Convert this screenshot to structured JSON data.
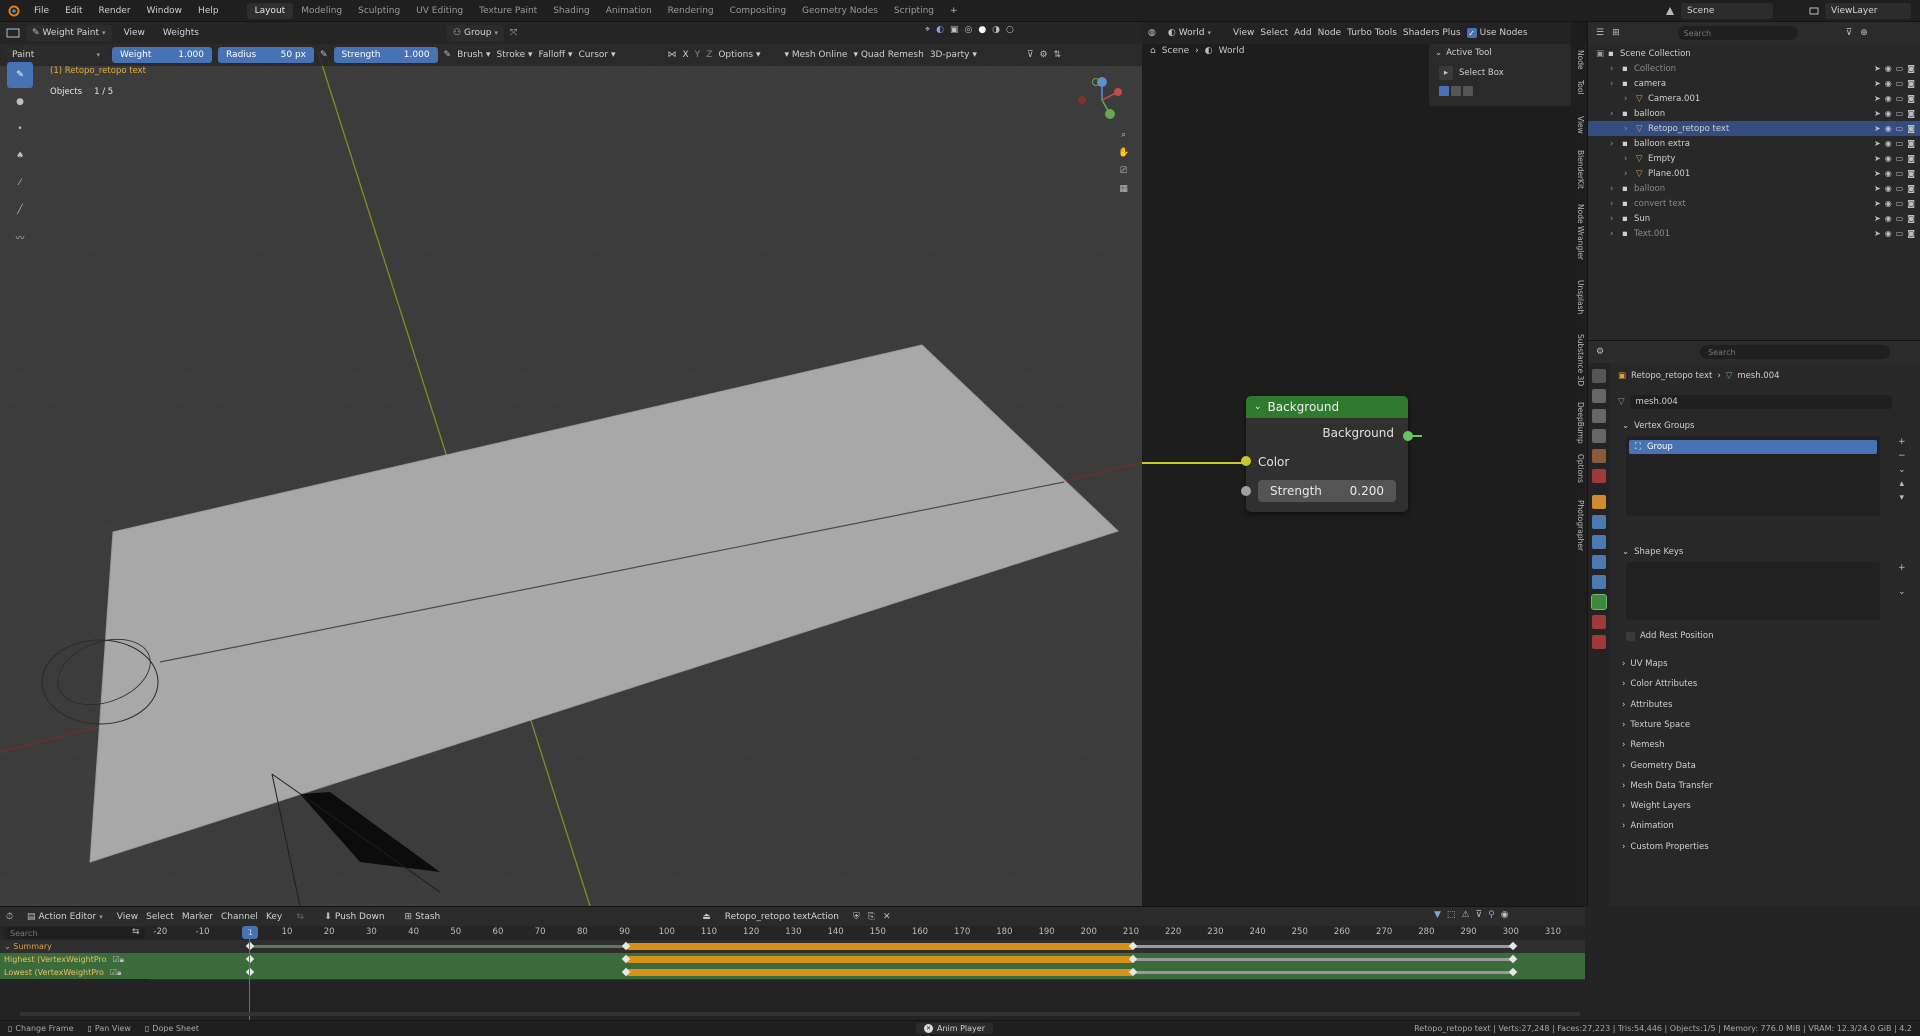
{
  "topbar": {
    "menus": [
      "File",
      "Edit",
      "Render",
      "Window",
      "Help"
    ],
    "workspaces": [
      "Layout",
      "Modeling",
      "Sculpting",
      "UV Editing",
      "Texture Paint",
      "Shading",
      "Animation",
      "Rendering",
      "Compositing",
      "Geometry Nodes",
      "Scripting"
    ],
    "active_workspace": "Layout",
    "scene": "Scene",
    "view_layer": "ViewLayer"
  },
  "viewport": {
    "mode": "Weight Paint",
    "view_menu": "View",
    "weights_menu": "Weights",
    "group_label": "Group",
    "brush_name": "Paint",
    "weight_label": "Weight",
    "weight_value": "1.000",
    "radius_label": "Radius",
    "radius_value": "50 px",
    "strength_label": "Strength",
    "strength_value": "1.000",
    "brush_menu": "Brush",
    "stroke_menu": "Stroke",
    "falloff_menu": "Falloff",
    "cursor_menu": "Cursor",
    "options_menu": "Options",
    "mesh_online": "Mesh Online",
    "quad_remesh": "Quad Remesh",
    "party": "3D-party",
    "axes": [
      "X",
      "Y",
      "Z"
    ],
    "object_name": "(1) Retopo_retopo text",
    "objects_label": "Objects",
    "objects_count": "1 / 5"
  },
  "node_editor": {
    "world": "World",
    "menus": [
      "View",
      "Select",
      "Add",
      "Node"
    ],
    "turbo_tools": "Turbo Tools",
    "shaders_plus": "Shaders Plus",
    "use_nodes": "Use Nodes",
    "breadcrumb": [
      "Scene",
      "World"
    ],
    "node": {
      "title": "Background",
      "output": "Background",
      "input_color": "Color",
      "strength_label": "Strength",
      "strength_value": "0.200"
    },
    "active_tool_title": "Active Tool",
    "active_tool_name": "Select Box",
    "side_tabs": [
      "Node",
      "Tool",
      "View",
      "BlenderKit",
      "Node Wrangler",
      "Unsplash",
      "Substance 3D",
      "DeepBump",
      "Options",
      "Photographer"
    ]
  },
  "outliner": {
    "search_placeholder": "Search",
    "items": [
      {
        "label": "Scene Collection",
        "indent": 0
      },
      {
        "label": "Collection",
        "indent": 1,
        "dim": true
      },
      {
        "label": "camera",
        "indent": 1
      },
      {
        "label": "Camera.001",
        "indent": 2
      },
      {
        "label": "balloon",
        "indent": 1
      },
      {
        "label": "Retopo_retopo text",
        "indent": 2,
        "selected": true
      },
      {
        "label": "balloon extra",
        "indent": 1
      },
      {
        "label": "Empty",
        "indent": 2
      },
      {
        "label": "Plane.001",
        "indent": 2
      },
      {
        "label": "balloon",
        "indent": 1,
        "dim": true
      },
      {
        "label": "convert text",
        "indent": 1,
        "dim": true
      },
      {
        "label": "Sun",
        "indent": 1
      },
      {
        "label": "Text.001",
        "indent": 1,
        "dim": true
      }
    ]
  },
  "properties": {
    "search_placeholder": "Search",
    "object_name": "Retopo_retopo text",
    "mesh_name": "mesh.004",
    "mesh_field": "mesh.004",
    "vertex_groups_title": "Vertex Groups",
    "vertex_group": "Group",
    "shape_keys_title": "Shape Keys",
    "add_rest_position": "Add Rest Position",
    "sections": [
      "UV Maps",
      "Color Attributes",
      "Attributes",
      "Texture Space",
      "Remesh",
      "Geometry Data",
      "Mesh Data Transfer",
      "Weight Layers",
      "Animation",
      "Custom Properties"
    ]
  },
  "action_editor": {
    "editor_type": "Action Editor",
    "menus": [
      "View",
      "Select",
      "Marker",
      "Channel",
      "Key"
    ],
    "push_down": "Push Down",
    "stash": "Stash",
    "action_name": "Retopo_retopo textAction",
    "search_placeholder": "Search",
    "current_frame": "1",
    "ticks": [
      "-20",
      "-10",
      "10",
      "20",
      "30",
      "40",
      "50",
      "60",
      "70",
      "80",
      "90",
      "100",
      "110",
      "120",
      "130",
      "140",
      "150",
      "160",
      "170",
      "180",
      "190",
      "200",
      "210",
      "220",
      "230",
      "240",
      "250",
      "260",
      "270",
      "280",
      "290",
      "300",
      "310"
    ],
    "channels": [
      "Summary",
      "Highest (VertexWeightPro",
      "Lowest (VertexWeightPro"
    ]
  },
  "statusbar": {
    "change_frame": "Change Frame",
    "pan_view": "Pan View",
    "dope_sheet": "Dope Sheet",
    "anim_player": "Anim Player",
    "stats": "Retopo_retopo text | Verts:27,248 | Faces:27,223 | Tris:54,446 | Objects:1/5 | Memory: 776.0 MiB | VRAM: 12.3/24.0 GiB | 4.2"
  },
  "colors": {
    "accent": "#4772b3",
    "node_header": "#2f7a2f",
    "keyframe_bar": "#d9901a",
    "channel_green": "#3f8a3f"
  }
}
